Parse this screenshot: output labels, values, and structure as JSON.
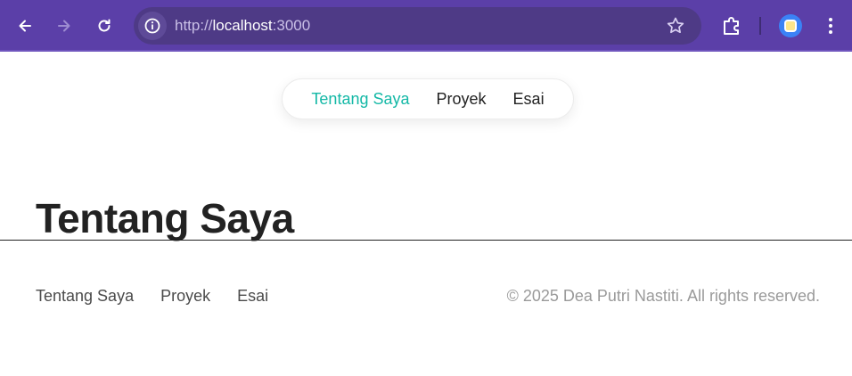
{
  "browser": {
    "url_scheme": "http://",
    "url_host": "localhost",
    "url_port": ":3000",
    "icons": [
      "arrow-left-icon",
      "arrow-right-icon",
      "reload-icon",
      "info-icon",
      "star-icon",
      "puzzle-icon",
      "profile-avatar",
      "kebab-menu-icon"
    ],
    "colors": {
      "chrome": "#5b3fa8",
      "omnibox": "#4e3a86"
    }
  },
  "nav": {
    "items": [
      {
        "label": "Tentang Saya",
        "active": true
      },
      {
        "label": "Proyek",
        "active": false
      },
      {
        "label": "Esai",
        "active": false
      }
    ],
    "accent": "#14b8a6"
  },
  "main": {
    "title": "Tentang Saya"
  },
  "footer": {
    "links": [
      "Tentang Saya",
      "Proyek",
      "Esai"
    ],
    "copyright": "© 2025 Dea Putri Nastiti. All rights reserved."
  }
}
